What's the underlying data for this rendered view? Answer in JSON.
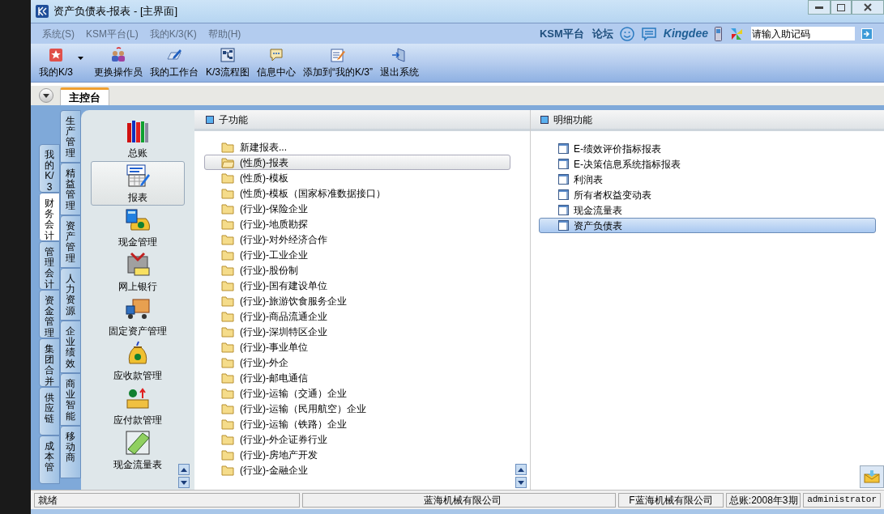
{
  "window": {
    "title": "资产负债表-报表 - [主界面]"
  },
  "menu": [
    {
      "label": "系统(S)"
    },
    {
      "label": "KSM平台(L)"
    },
    {
      "label": "我的K/3(K)"
    },
    {
      "label": "帮助(H)"
    }
  ],
  "header_links": [
    {
      "label": "KSM平台"
    },
    {
      "label": "论坛"
    }
  ],
  "brand": "Kingdee",
  "search": {
    "placeholder": "请输入助记码"
  },
  "toolbar": [
    {
      "label": "我的K/3",
      "dropdown": true
    },
    {
      "label": "更换操作员",
      "dropdown": false
    },
    {
      "label": "我的工作台",
      "dropdown": false
    },
    {
      "label": "K/3流程图",
      "dropdown": false
    },
    {
      "label": "信息中心",
      "dropdown": false
    },
    {
      "label": "添加到“我的K/3”",
      "dropdown": false
    },
    {
      "label": "退出系统",
      "dropdown": false
    }
  ],
  "tabs": [
    {
      "label": "主控台",
      "selected": true
    }
  ],
  "side_tabs_outer": [
    {
      "label": "我的K/3",
      "selected": false
    },
    {
      "label": "财务会计",
      "selected": true
    },
    {
      "label": "管理会计",
      "selected": false
    },
    {
      "label": "资金管理",
      "selected": false
    },
    {
      "label": "集团合并",
      "selected": false
    },
    {
      "label": "供应链",
      "selected": false
    },
    {
      "label": "成本管",
      "selected": false
    }
  ],
  "side_tabs_inner": [
    {
      "label": "生产管理"
    },
    {
      "label": "精益管理"
    },
    {
      "label": "资产管理"
    },
    {
      "label": "人力资源"
    },
    {
      "label": "企业绩效"
    },
    {
      "label": "商业智能"
    },
    {
      "label": "移动商"
    }
  ],
  "modules": [
    {
      "label": "总账",
      "selected": false
    },
    {
      "label": "报表",
      "selected": true
    },
    {
      "label": "现金管理",
      "selected": false
    },
    {
      "label": "网上银行",
      "selected": false
    },
    {
      "label": "固定资产管理",
      "selected": false
    },
    {
      "label": "应收款管理",
      "selected": false
    },
    {
      "label": "应付款管理",
      "selected": false
    },
    {
      "label": "现金流量表",
      "selected": false
    }
  ],
  "sub_functions": {
    "title": "子功能",
    "items": [
      {
        "label": "新建报表...",
        "selected": false
      },
      {
        "label": "(性质)-报表",
        "selected": true
      },
      {
        "label": "(性质)-模板",
        "selected": false
      },
      {
        "label": "(性质)-模板（国家标准数据接口）",
        "selected": false
      },
      {
        "label": "(行业)-保险企业",
        "selected": false
      },
      {
        "label": "(行业)-地质勘探",
        "selected": false
      },
      {
        "label": "(行业)-对外经济合作",
        "selected": false
      },
      {
        "label": "(行业)-工业企业",
        "selected": false
      },
      {
        "label": "(行业)-股份制",
        "selected": false
      },
      {
        "label": "(行业)-国有建设单位",
        "selected": false
      },
      {
        "label": "(行业)-旅游饮食服务企业",
        "selected": false
      },
      {
        "label": "(行业)-商品流通企业",
        "selected": false
      },
      {
        "label": "(行业)-深圳特区企业",
        "selected": false
      },
      {
        "label": "(行业)-事业单位",
        "selected": false
      },
      {
        "label": "(行业)-外企",
        "selected": false
      },
      {
        "label": "(行业)-邮电通信",
        "selected": false
      },
      {
        "label": "(行业)-运输（交通）企业",
        "selected": false
      },
      {
        "label": "(行业)-运输（民用航空）企业",
        "selected": false
      },
      {
        "label": "(行业)-运输（铁路）企业",
        "selected": false
      },
      {
        "label": "(行业)-外企证券行业",
        "selected": false
      },
      {
        "label": "(行业)-房地产开发",
        "selected": false
      },
      {
        "label": "(行业)-金融企业",
        "selected": false
      }
    ]
  },
  "detail_functions": {
    "title": "明细功能",
    "items": [
      {
        "label": "E-绩效评价指标报表",
        "selected": false
      },
      {
        "label": "E-决策信息系统指标报表",
        "selected": false
      },
      {
        "label": "利润表",
        "selected": false
      },
      {
        "label": "所有者权益变动表",
        "selected": false
      },
      {
        "label": "现金流量表",
        "selected": false
      },
      {
        "label": "资产负债表",
        "selected": true
      }
    ]
  },
  "status_bar": [
    "就绪",
    "蓝海机械有限公司",
    "F蓝海机械有限公司",
    "总账:2008年3期",
    "administrator"
  ]
}
